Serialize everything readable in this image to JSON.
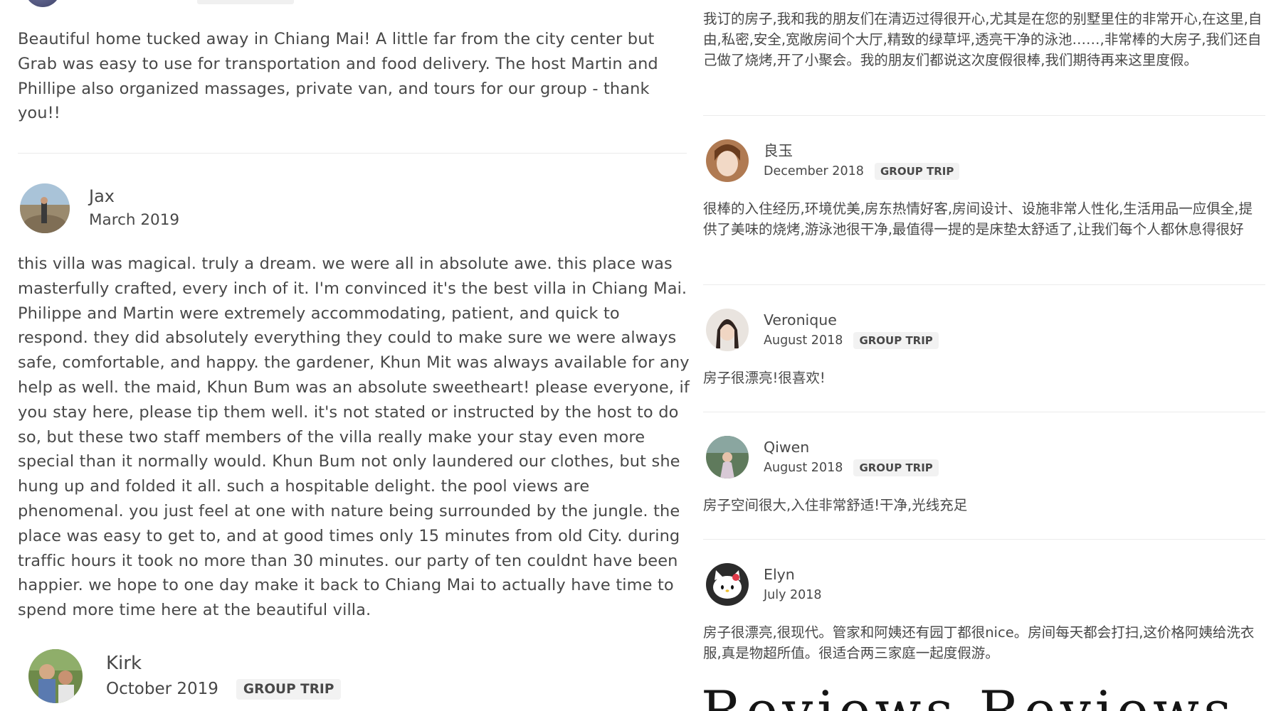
{
  "left_column": {
    "review_1": {
      "text": "Beautiful home tucked away in Chiang Mai! A little far from the city center but Grab was easy to use for transportation and food delivery. The host Martin and Phillipe also organized massages, private van, and tours for our group - thank you!!"
    },
    "review_2": {
      "name": "Jax",
      "date": "March 2019",
      "text": "this villa was magical. truly a dream. we were all in absolute awe. this place was masterfully crafted, every inch of it. I'm convinced it's the best villa in Chiang Mai. Philippe and Martin were extremely accommodating, patient, and quick to respond. they did absolutely everything they could to make sure we were always safe, comfortable, and happy. the gardener, Khun Mit was always available for any help as well. the maid, Khun Bum was an absolute sweetheart! please everyone, if you stay here, please tip them well. it's not stated or instructed by the host to do so, but these two staff members of the villa really make your stay even more special than it normally would. Khun Bum not only laundered our clothes, but she hung up and folded it all. such a hospitable delight. the pool views are phenomenal. you just feel at one with nature being surrounded by the jungle. the place was easy to get to, and at good times only 15 minutes from old City. during traffic hours it took no more than 30 minutes. our party of ten couldnt have been happier. we hope to one day make it back to Chiang Mai to actually have time to spend more time here at the beautiful villa."
    },
    "review_3": {
      "name": "Kirk",
      "date": "October 2019",
      "badge": "GROUP TRIP"
    }
  },
  "right_column": {
    "review_1": {
      "text": "我订的房子,我和我的朋友们在清迈过得很开心,尤其是在您的别墅里住的非常开心,在这里,自由,私密,安全,宽敞房间个大厅,精致的绿草坪,透亮干净的泳池……,非常棒的大房子,我们还自己做了烧烤,开了小聚会。我的朋友们都说这次度假很棒,我们期待再来这里度假。"
    },
    "review_2": {
      "name": "良玉",
      "date": "December 2018",
      "badge": "GROUP TRIP",
      "text": "很棒的入住经历,环境优美,房东热情好客,房间设计、设施非常人性化,生活用品一应俱全,提供了美味的烧烤,游泳池很干净,最值得一提的是床垫太舒适了,让我们每个人都休息得很好"
    },
    "review_3": {
      "name": "Veronique",
      "date": "August 2018",
      "badge": "GROUP TRIP",
      "text": "房子很漂亮!很喜欢!"
    },
    "review_4": {
      "name": "Qiwen",
      "date": "August 2018",
      "badge": "GROUP TRIP",
      "text": "房子空间很大,入住非常舒适!干净,光线充足"
    },
    "review_5": {
      "name": "Elyn",
      "date": "July 2018",
      "text": "房子很漂亮,很现代。管家和阿姨还有园丁都很nice。房间每天都会打扫,这价格阿姨给洗衣服,真是物超所值。很适合两三家庭一起度假游。"
    }
  },
  "watermark": {
    "text": "Reviews Reviews"
  },
  "colors": {
    "text": "#484848",
    "divider": "#ebebeb",
    "badge_bg": "#f2f2f2",
    "watermark": "#151515"
  },
  "icons": {
    "avatars": [
      "avatar-photo-icon",
      "hello-kitty-avatar-icon"
    ]
  }
}
